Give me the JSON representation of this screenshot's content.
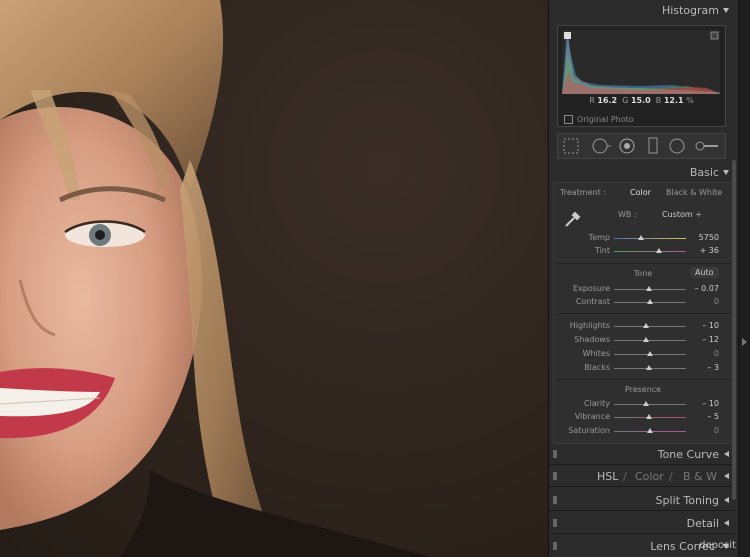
{
  "histogram": {
    "title": "Histogram",
    "r_label": "R",
    "r_value": "16.2",
    "g_label": "G",
    "g_value": "15.0",
    "b_label": "B",
    "b_value": "12.1",
    "percent": "%",
    "original_photo": "Original Photo"
  },
  "basic": {
    "title": "Basic",
    "treatment_label": "Treatment :",
    "treatment_color": "Color",
    "treatment_bw": "Black & White",
    "wb_label": "WB :",
    "wb_value": "Custom",
    "temp": {
      "label": "Temp",
      "value": "5750",
      "position": 0.38
    },
    "tint": {
      "label": "Tint",
      "value": "+ 36",
      "position": 0.62
    },
    "tone_label": "Tone",
    "auto_label": "Auto",
    "exposure": {
      "label": "Exposure",
      "value": "– 0.07",
      "position": 0.49
    },
    "contrast": {
      "label": "Contrast",
      "value": "0",
      "position": 0.5
    },
    "highlights": {
      "label": "Highlights",
      "value": "– 10",
      "position": 0.45
    },
    "shadows": {
      "label": "Shadows",
      "value": "– 12",
      "position": 0.44
    },
    "whites": {
      "label": "Whites",
      "value": "0",
      "position": 0.5
    },
    "blacks": {
      "label": "Blacks",
      "value": "– 3",
      "position": 0.49
    },
    "presence_label": "Presence",
    "clarity": {
      "label": "Clarity",
      "value": "– 10",
      "position": 0.45
    },
    "vibrance": {
      "label": "Vibrance",
      "value": "– 5",
      "position": 0.48
    },
    "saturation": {
      "label": "Saturation",
      "value": "0",
      "position": 0.5
    }
  },
  "sections": {
    "tone_curve": "Tone Curve",
    "hsl": "HSL",
    "color": "Color",
    "bw": "B & W",
    "split_toning": "Split Toning",
    "detail": "Detail",
    "lens_corrections": "Lens Correc"
  },
  "watermark": "deposit"
}
